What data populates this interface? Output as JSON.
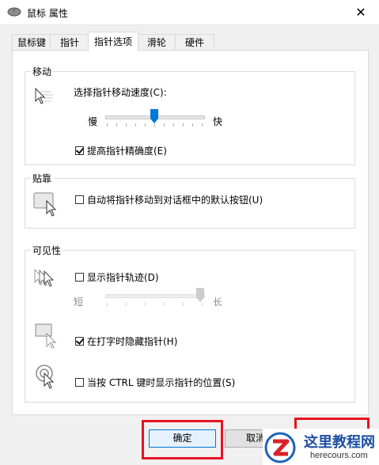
{
  "window": {
    "title": "鼠标 属性",
    "close_glyph": "✕"
  },
  "tabs": [
    {
      "label": "鼠标键",
      "active": false
    },
    {
      "label": "指针",
      "active": false
    },
    {
      "label": "指针选项",
      "active": true
    },
    {
      "label": "滑轮",
      "active": false
    },
    {
      "label": "硬件",
      "active": false
    }
  ],
  "motion": {
    "group_label": "移动",
    "speed_label": "选择指针移动速度(C):",
    "slow_label": "慢",
    "fast_label": "快",
    "speed_value": 6,
    "speed_max": 11,
    "precision_label": "提高指针精确度(E)",
    "precision_checked": true
  },
  "snap": {
    "group_label": "贴靠",
    "snap_label": "自动将指针移动到对话框中的默认按钮(U)",
    "snap_checked": false
  },
  "visibility": {
    "group_label": "可见性",
    "trails_label": "显示指针轨迹(D)",
    "trails_checked": false,
    "short_label": "短",
    "long_label": "长",
    "hide_typing_label": "在打字时隐藏指针(H)",
    "hide_typing_checked": true,
    "ctrl_label": "当按 CTRL 键时显示指针的位置(S)",
    "ctrl_checked": false
  },
  "footer": {
    "ok_label": "确定",
    "cancel_label": "取消"
  },
  "watermark": {
    "main": "这里教程网",
    "sub": "herecours.com"
  },
  "colors": {
    "accent": "#0078d7",
    "highlight": "#e81123"
  }
}
